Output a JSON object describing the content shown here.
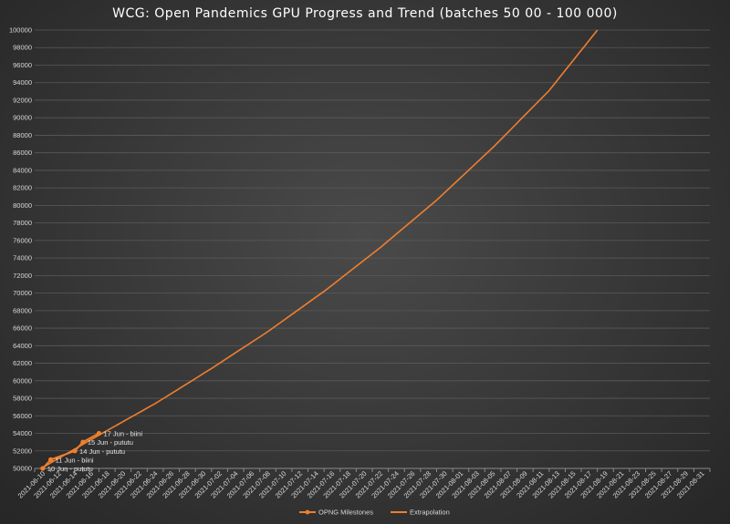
{
  "chart_data": {
    "type": "line",
    "title": "WCG: Open Pandemics GPU Progress and Trend (batches 50 00 - 100 000)",
    "xlabel": "",
    "ylabel": "",
    "ylim": [
      50000,
      100000
    ],
    "ytick_step": 2000,
    "x_categories": [
      "2021-06-10",
      "2021-06-12",
      "2021-06-14",
      "2021-06-16",
      "2021-06-18",
      "2021-06-20",
      "2021-06-22",
      "2021-06-24",
      "2021-06-26",
      "2021-06-28",
      "2021-06-30",
      "2021-07-02",
      "2021-07-04",
      "2021-07-06",
      "2021-07-08",
      "2021-07-10",
      "2021-07-12",
      "2021-07-14",
      "2021-07-16",
      "2021-07-18",
      "2021-07-20",
      "2021-07-22",
      "2021-07-24",
      "2021-07-26",
      "2021-07-28",
      "2021-07-30",
      "2021-08-01",
      "2021-08-03",
      "2021-08-05",
      "2021-08-07",
      "2021-08-09",
      "2021-08-11",
      "2021-08-13",
      "2021-08-15",
      "2021-08-17",
      "2021-08-19",
      "2021-08-21",
      "2021-08-23",
      "2021-08-25",
      "2021-08-27",
      "2021-08-29",
      "2021-08-31"
    ],
    "grid": "horizontal",
    "legend_position": "bottom",
    "colors": {
      "series": "#f07f2e",
      "grid": "#5a5a5a",
      "axis": "#8a8a8a"
    },
    "series": [
      {
        "name": "OPNG Milestones",
        "marker": true,
        "points": [
          {
            "x": "2021-06-10",
            "y": 50000
          },
          {
            "x": "2021-06-11",
            "y": 51000
          },
          {
            "x": "2021-06-14",
            "y": 52000
          },
          {
            "x": "2021-06-15",
            "y": 53000
          },
          {
            "x": "2021-06-17",
            "y": 54000
          }
        ]
      },
      {
        "name": "Extrapolation",
        "marker": false,
        "points": [
          {
            "x": "2021-06-10",
            "y": 50100
          },
          {
            "x": "2021-06-17",
            "y": 53800
          },
          {
            "x": "2021-06-24",
            "y": 57400
          },
          {
            "x": "2021-07-01",
            "y": 61400
          },
          {
            "x": "2021-07-08",
            "y": 65600
          },
          {
            "x": "2021-07-15",
            "y": 70200
          },
          {
            "x": "2021-07-22",
            "y": 75200
          },
          {
            "x": "2021-07-29",
            "y": 80600
          },
          {
            "x": "2021-08-05",
            "y": 86600
          },
          {
            "x": "2021-08-12",
            "y": 93100
          },
          {
            "x": "2021-08-18",
            "y": 100000
          }
        ]
      }
    ],
    "annotations": [
      {
        "x": "2021-06-10",
        "y": 50000,
        "text": "10 Jun - pututu"
      },
      {
        "x": "2021-06-11",
        "y": 51000,
        "text": "11 Jun - biini"
      },
      {
        "x": "2021-06-14",
        "y": 52000,
        "text": "14 Jun - pututu"
      },
      {
        "x": "2021-06-15",
        "y": 53000,
        "text": "15 Jun - pututu"
      },
      {
        "x": "2021-06-17",
        "y": 54000,
        "text": "17 Jun - biini"
      }
    ]
  }
}
